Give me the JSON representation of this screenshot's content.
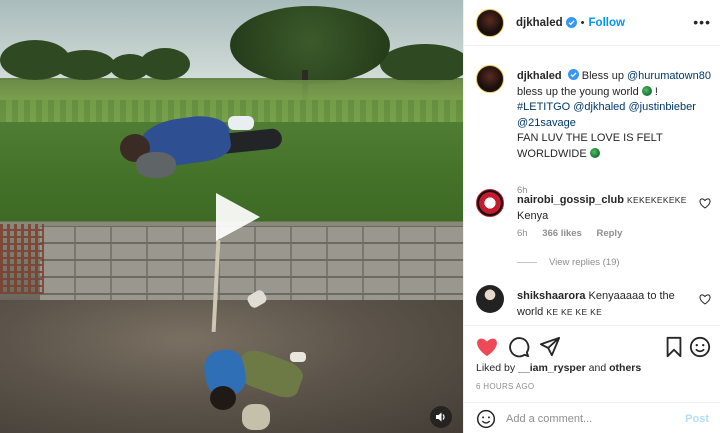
{
  "post": {
    "author": "djkhaled",
    "follow_label": "Follow",
    "caption": {
      "author": "djkhaled",
      "line1_text": "Bless up",
      "mention1": "@hurumatown80",
      "line2_text": "bless up the young world",
      "line2_after": "!",
      "hashtag": "#LETITGO",
      "mention2": "@djkhaled",
      "mention3": "@justinbieber",
      "mention4": "@21savage",
      "line5": "FAN LUV THE LOVE IS FELT",
      "line6": "WORLDWIDE",
      "time": "6h"
    },
    "comments": [
      {
        "author": "nairobi_gossip_club",
        "author_suffix": "KEKEKEKEKE",
        "text": "Kenya",
        "time": "6h",
        "likes": "366 likes",
        "reply": "Reply"
      },
      {
        "author": "shikshaarora",
        "text_line1": "Kenyaaaaa to the",
        "text_line2_word": "world",
        "text_line2_rest": "KE KE KE KE"
      }
    ],
    "view_replies": "View replies (19)",
    "liked_by_prefix": "Liked by",
    "liked_by_user": "__iam_rysper",
    "liked_by_and": "and",
    "liked_by_others": "others",
    "timeago": "6 HOURS AGO",
    "add_comment_placeholder": "Add a comment...",
    "post_label": "Post"
  },
  "icons": {
    "verified": "verified-badge-icon",
    "more": "more-options-icon",
    "play": "play-icon",
    "sound": "sound-icon",
    "heart": "heart-icon",
    "comment": "comment-icon",
    "share": "share-icon",
    "save": "bookmark-icon",
    "emoji": "emoji-icon"
  },
  "colors": {
    "accent": "#0095f6",
    "link": "#00376b",
    "like_red": "#ed4956",
    "muted": "#8e8e8e"
  }
}
